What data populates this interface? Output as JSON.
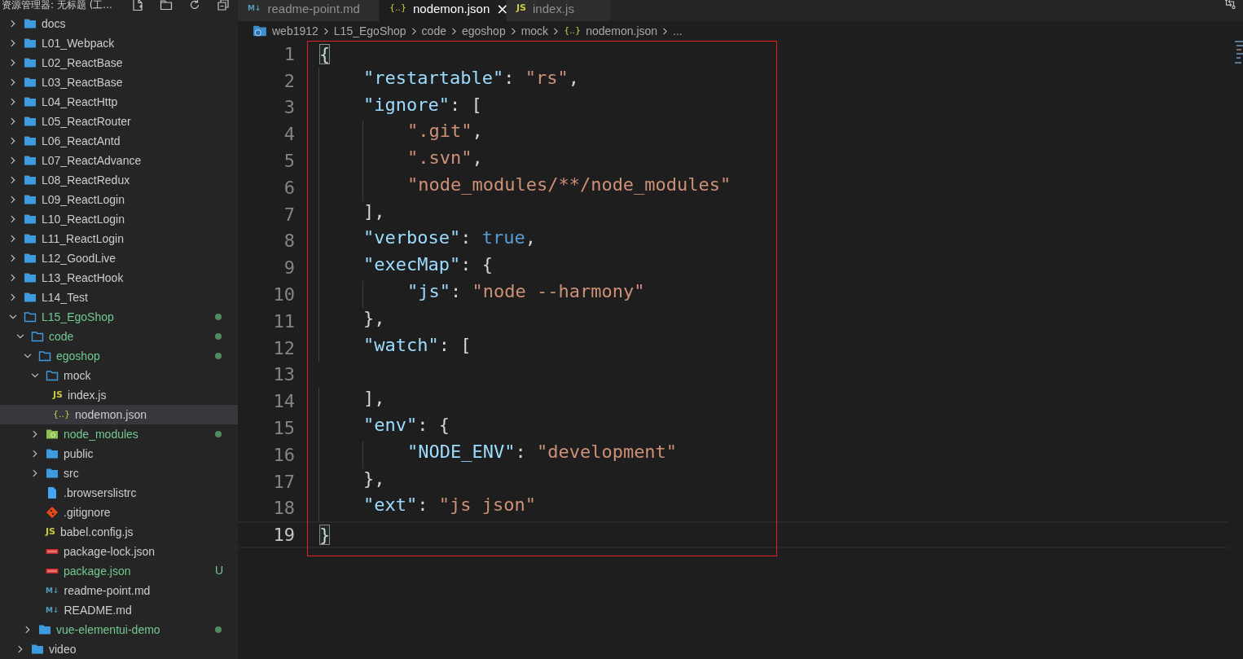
{
  "sidebar": {
    "title": "资源管理器: 无标题 (工...",
    "tree": [
      {
        "label": "docs",
        "kind": "folder",
        "expanded": false
      },
      {
        "label": "L01_Webpack",
        "kind": "folder",
        "expanded": false
      },
      {
        "label": "L02_ReactBase",
        "kind": "folder",
        "expanded": false
      },
      {
        "label": "L03_ReactBase",
        "kind": "folder",
        "expanded": false
      },
      {
        "label": "L04_ReactHttp",
        "kind": "folder",
        "expanded": false
      },
      {
        "label": "L05_ReactRouter",
        "kind": "folder",
        "expanded": false
      },
      {
        "label": "L06_ReactAntd",
        "kind": "folder",
        "expanded": false
      },
      {
        "label": "L07_ReactAdvance",
        "kind": "folder",
        "expanded": false
      },
      {
        "label": "L08_ReactRedux",
        "kind": "folder",
        "expanded": false
      },
      {
        "label": "L09_ReactLogin",
        "kind": "folder",
        "expanded": false
      },
      {
        "label": "L10_ReactLogin",
        "kind": "folder",
        "expanded": false
      },
      {
        "label": "L11_ReactLogin",
        "kind": "folder",
        "expanded": false
      },
      {
        "label": "L12_GoodLive",
        "kind": "folder",
        "expanded": false
      },
      {
        "label": "L13_ReactHook",
        "kind": "folder",
        "expanded": false
      },
      {
        "label": "L14_Test",
        "kind": "folder",
        "expanded": false
      },
      {
        "label": "L15_EgoShop",
        "kind": "folder",
        "expanded": true,
        "changed": true,
        "dot": true,
        "children": [
          {
            "label": "code",
            "kind": "folder",
            "expanded": true,
            "changed": true,
            "dot": true,
            "children": [
              {
                "label": "egoshop",
                "kind": "folder",
                "expanded": true,
                "changed": true,
                "dot": true,
                "children": [
                  {
                    "label": "mock",
                    "kind": "folder",
                    "expanded": true,
                    "children": [
                      {
                        "label": "index.js",
                        "kind": "js",
                        "icon_text": "JS",
                        "selected": false
                      },
                      {
                        "label": "nodemon.json",
                        "kind": "json",
                        "icon_text": "{..}",
                        "selected": true
                      }
                    ]
                  },
                  {
                    "label": "node_modules",
                    "kind": "node-folder",
                    "expanded": false,
                    "changed": true,
                    "dot": true
                  },
                  {
                    "label": "public",
                    "kind": "folder",
                    "expanded": false
                  },
                  {
                    "label": "src",
                    "kind": "folder",
                    "expanded": false
                  },
                  {
                    "label": ".browserslistrc",
                    "kind": "file"
                  },
                  {
                    "label": ".gitignore",
                    "kind": "git"
                  },
                  {
                    "label": "babel.config.js",
                    "kind": "js",
                    "icon_text": "JS"
                  },
                  {
                    "label": "package-lock.json",
                    "kind": "npm"
                  },
                  {
                    "label": "package.json",
                    "kind": "npm",
                    "changed": true,
                    "badge": "U"
                  },
                  {
                    "label": "readme-point.md",
                    "kind": "md",
                    "icon_text": "M↓"
                  },
                  {
                    "label": "README.md",
                    "kind": "md",
                    "icon_text": "M↓"
                  }
                ]
              },
              {
                "label": "vue-elementui-demo",
                "kind": "folder",
                "expanded": false,
                "changed": true,
                "dot": true
              }
            ]
          },
          {
            "label": "video",
            "kind": "folder",
            "expanded": false
          }
        ]
      }
    ]
  },
  "tabs": [
    {
      "label": "readme-point.md",
      "kind": "md",
      "icon_text": "M↓",
      "selected": false
    },
    {
      "label": "nodemon.json",
      "kind": "json",
      "icon_text": "{..}",
      "selected": true,
      "close": "×"
    },
    {
      "label": "index.js",
      "kind": "js",
      "icon_text": "JS",
      "selected": false
    }
  ],
  "breadcrumb": [
    {
      "label": "web1912",
      "kind": "folder"
    },
    {
      "label": "L15_EgoShop"
    },
    {
      "label": "code"
    },
    {
      "label": "egoshop"
    },
    {
      "label": "mock"
    },
    {
      "label": "nodemon.json",
      "kind": "json",
      "icon_text": "{..}"
    },
    {
      "label": "..."
    }
  ],
  "editor": {
    "lines": [
      {
        "number": "1",
        "current": false,
        "tokens": [
          {
            "kind": "punct",
            "text": "{",
            "match": true
          }
        ]
      },
      {
        "number": "2",
        "current": false,
        "tokens": [
          {
            "kind": "key",
            "text": "    \"restartable\""
          },
          {
            "kind": "punct",
            "text": ": "
          },
          {
            "kind": "string",
            "text": "\"rs\""
          },
          {
            "kind": "punct",
            "text": ","
          }
        ]
      },
      {
        "number": "3",
        "current": false,
        "tokens": [
          {
            "kind": "key",
            "text": "    \"ignore\""
          },
          {
            "kind": "punct",
            "text": ": ["
          }
        ]
      },
      {
        "number": "4",
        "current": false,
        "tokens": [
          {
            "kind": "string",
            "text": "        \".git\""
          },
          {
            "kind": "punct",
            "text": ","
          }
        ]
      },
      {
        "number": "5",
        "current": false,
        "tokens": [
          {
            "kind": "string",
            "text": "        \".svn\""
          },
          {
            "kind": "punct",
            "text": ","
          }
        ]
      },
      {
        "number": "6",
        "current": false,
        "tokens": [
          {
            "kind": "string",
            "text": "        \"node_modules/**/node_modules\""
          }
        ]
      },
      {
        "number": "7",
        "current": false,
        "tokens": [
          {
            "kind": "punct",
            "text": "    ],"
          }
        ]
      },
      {
        "number": "8",
        "current": false,
        "tokens": [
          {
            "kind": "key",
            "text": "    \"verbose\""
          },
          {
            "kind": "punct",
            "text": ": "
          },
          {
            "kind": "bool",
            "text": "true"
          },
          {
            "kind": "punct",
            "text": ","
          }
        ]
      },
      {
        "number": "9",
        "current": false,
        "tokens": [
          {
            "kind": "key",
            "text": "    \"execMap\""
          },
          {
            "kind": "punct",
            "text": ": {"
          }
        ]
      },
      {
        "number": "10",
        "current": false,
        "tokens": [
          {
            "kind": "key",
            "text": "        \"js\""
          },
          {
            "kind": "punct",
            "text": ": "
          },
          {
            "kind": "string",
            "text": "\"node --harmony\""
          }
        ]
      },
      {
        "number": "11",
        "current": false,
        "tokens": [
          {
            "kind": "punct",
            "text": "    },"
          }
        ]
      },
      {
        "number": "12",
        "current": false,
        "tokens": [
          {
            "kind": "key",
            "text": "    \"watch\""
          },
          {
            "kind": "punct",
            "text": ": ["
          }
        ]
      },
      {
        "number": "13",
        "current": false
      },
      {
        "number": "14",
        "current": false,
        "tokens": [
          {
            "kind": "punct",
            "text": "    ],"
          }
        ]
      },
      {
        "number": "15",
        "current": false,
        "tokens": [
          {
            "kind": "key",
            "text": "    \"env\""
          },
          {
            "kind": "punct",
            "text": ": {"
          }
        ]
      },
      {
        "number": "16",
        "current": false,
        "tokens": [
          {
            "kind": "key",
            "text": "        \"NODE_ENV\""
          },
          {
            "kind": "punct",
            "text": ": "
          },
          {
            "kind": "string",
            "text": "\"development\""
          }
        ]
      },
      {
        "number": "17",
        "current": false,
        "tokens": [
          {
            "kind": "punct",
            "text": "    },"
          }
        ]
      },
      {
        "number": "18",
        "current": false,
        "tokens": [
          {
            "kind": "key",
            "text": "    \"ext\""
          },
          {
            "kind": "punct",
            "text": ": "
          },
          {
            "kind": "string",
            "text": "\"js json\""
          }
        ]
      },
      {
        "number": "19",
        "current": true,
        "tokens": [
          {
            "kind": "punct",
            "text": "}",
            "match": true
          }
        ]
      }
    ]
  }
}
